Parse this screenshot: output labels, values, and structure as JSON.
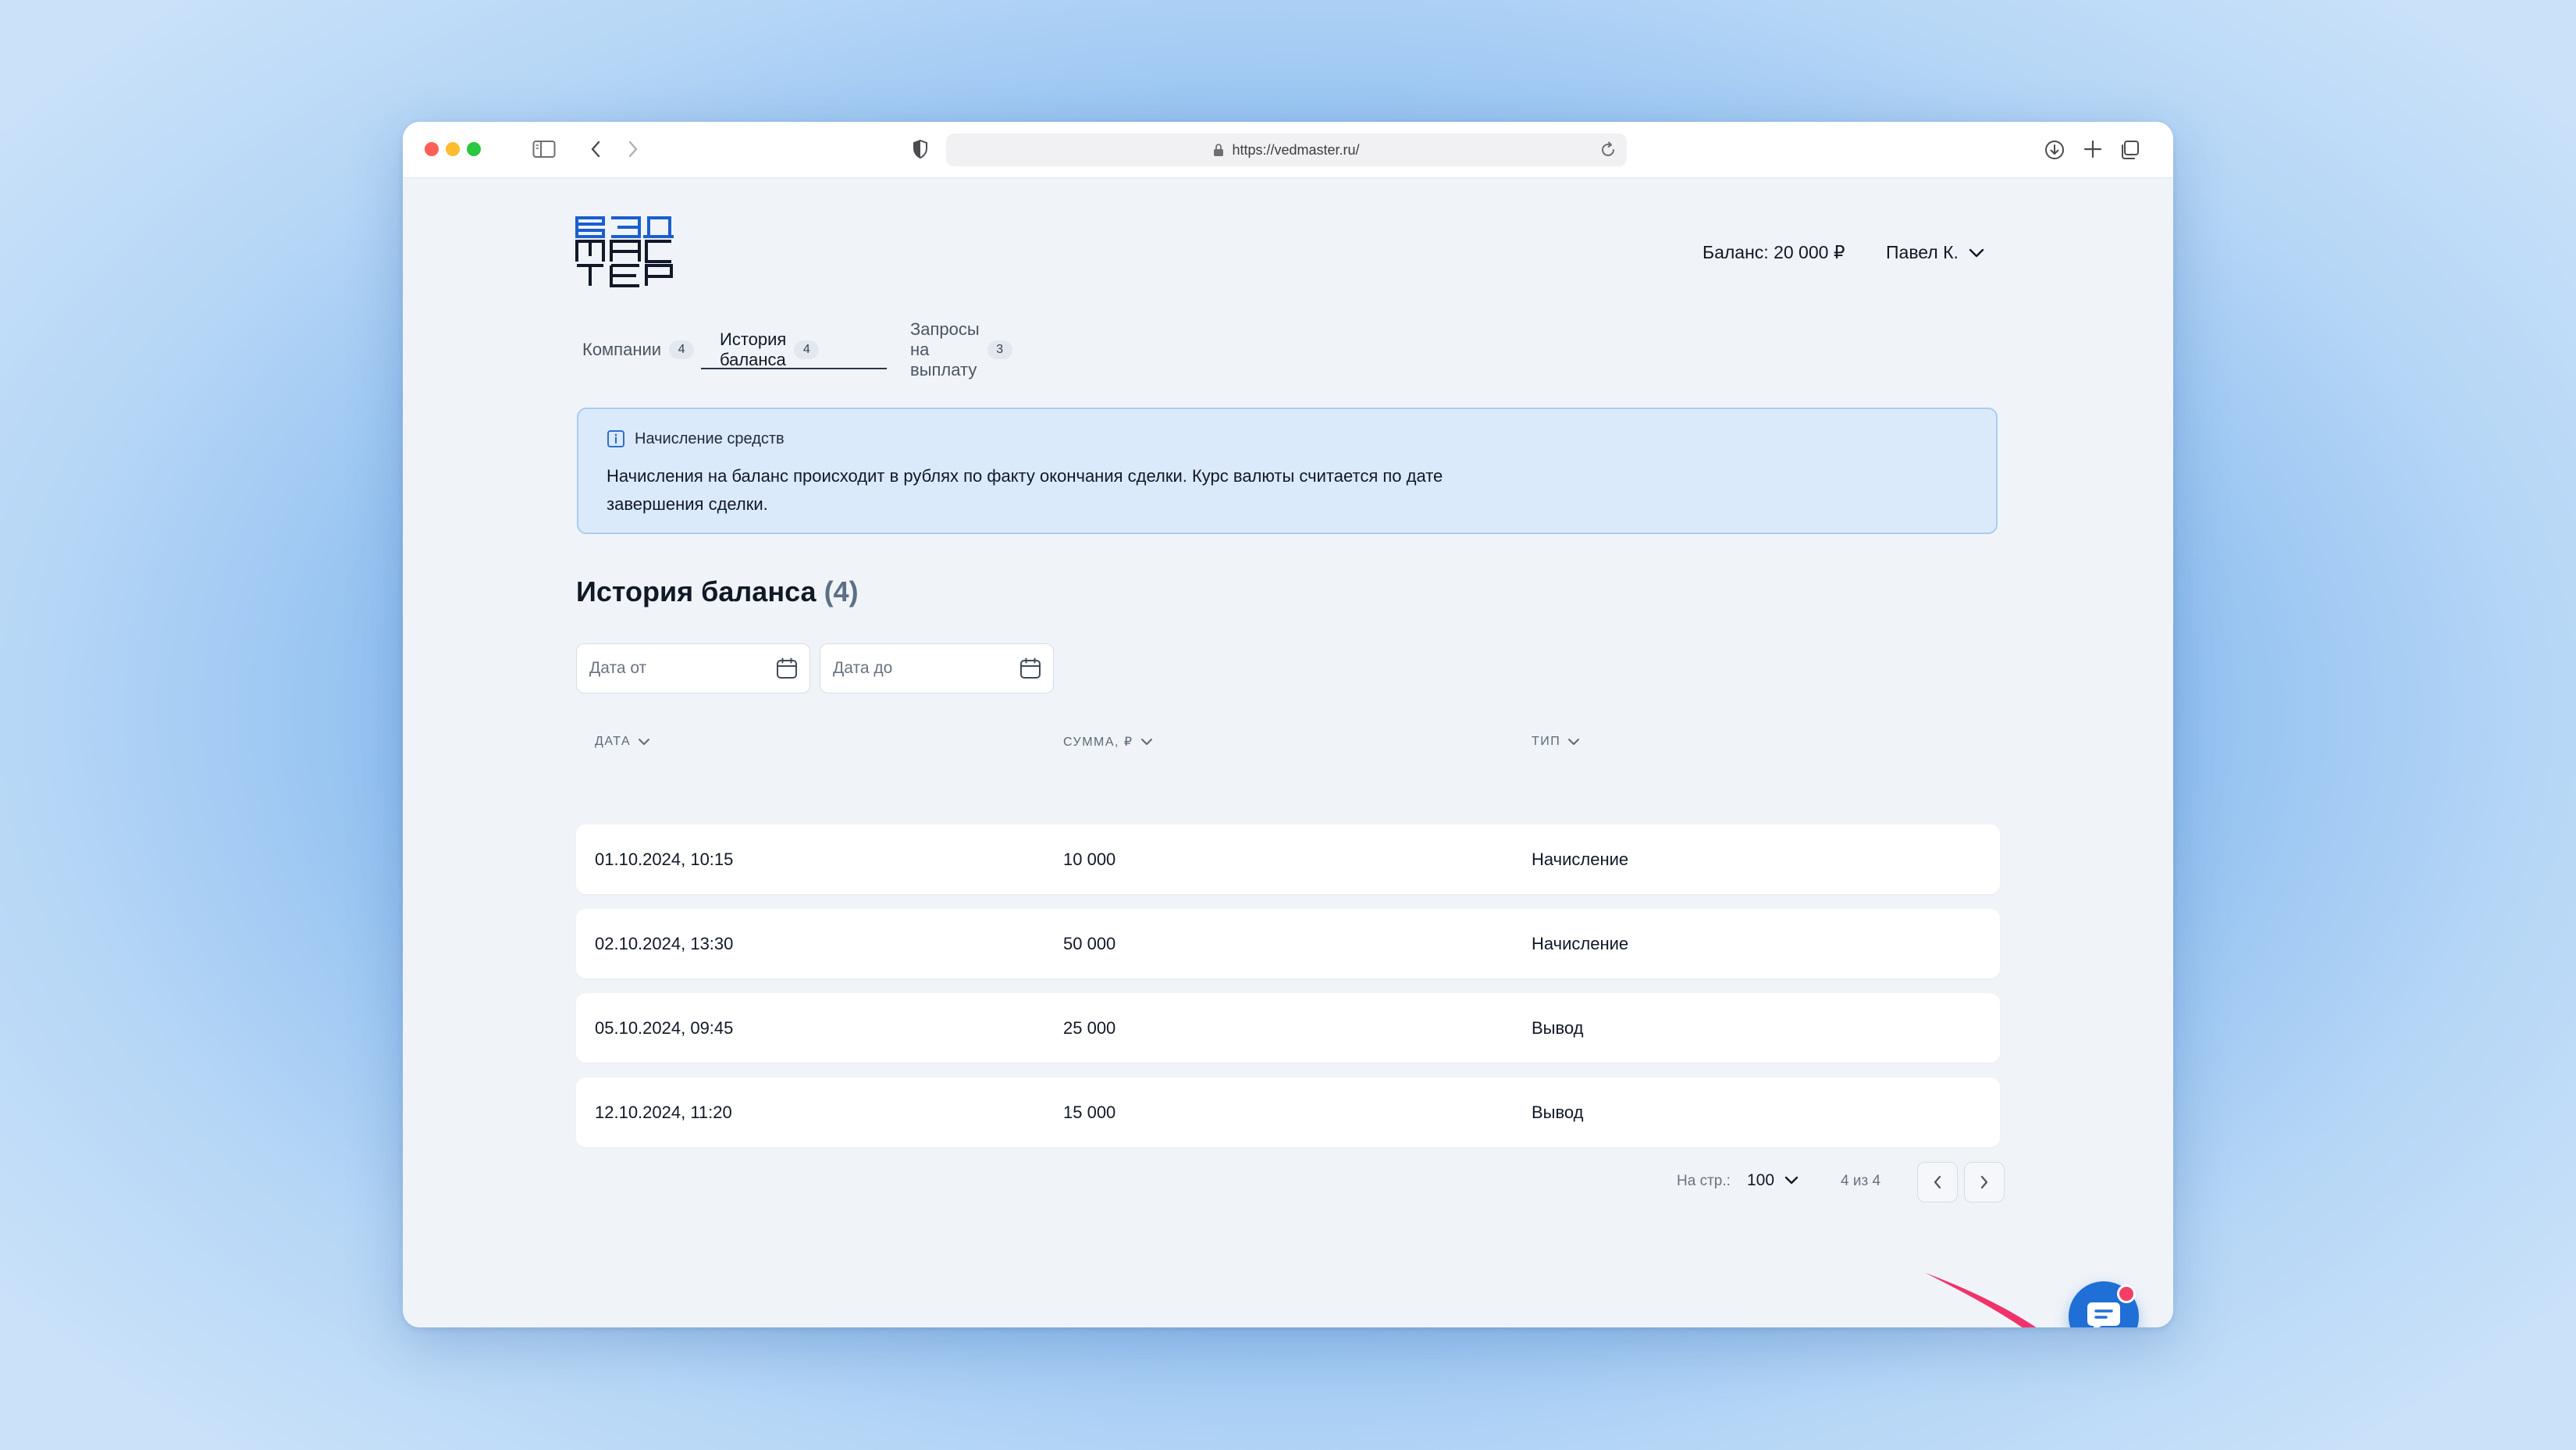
{
  "browser": {
    "url": "https://vedmaster.ru/"
  },
  "header": {
    "balance": "Баланс: 20 000 ₽",
    "user_name": "Павел К."
  },
  "tabs": [
    {
      "label": "Компании",
      "count": "4",
      "active": false
    },
    {
      "label": "История баланса",
      "count": "4",
      "active": true
    },
    {
      "label": "Запросы на выплату",
      "count": "3",
      "active": false
    }
  ],
  "info": {
    "title": "Начисление средств",
    "text": "Начисления на баланс происходит в рублях по факту окончания сделки. Курс валюты считается по дате завершения сделки."
  },
  "section": {
    "title": "История баланса",
    "count": "(4)"
  },
  "filters": {
    "date_from_placeholder": "Дата от",
    "date_to_placeholder": "Дата до"
  },
  "table": {
    "columns": [
      "ДАТА",
      "СУММА, ₽",
      "ТИП"
    ],
    "rows": [
      {
        "date": "01.10.2024, 10:15",
        "amount": "10 000",
        "type": "Начисление"
      },
      {
        "date": "02.10.2024, 13:30",
        "amount": "50 000",
        "type": "Начисление"
      },
      {
        "date": "05.10.2024, 09:45",
        "amount": "25 000",
        "type": "Вывод"
      },
      {
        "date": "12.10.2024, 11:20",
        "amount": "15 000",
        "type": "Вывод"
      }
    ]
  },
  "pagination": {
    "per_page_label": "На стр.:",
    "per_page_value": "100",
    "range": "4 из 4"
  },
  "colors": {
    "accent": "#1f6fd6",
    "logo_blue": "#1a5fd1",
    "info_bg": "#dbeafb",
    "annotation_arrow": "#f0336a",
    "notification_badge": "#f43f66"
  },
  "icons": [
    "sidebar-icon",
    "chevron-left-icon",
    "chevron-right-icon",
    "shield-icon",
    "lock-icon",
    "reload-icon",
    "download-icon",
    "plus-icon",
    "tabs-icon",
    "chevron-down-icon",
    "info-icon",
    "calendar-icon",
    "chat-icon"
  ]
}
